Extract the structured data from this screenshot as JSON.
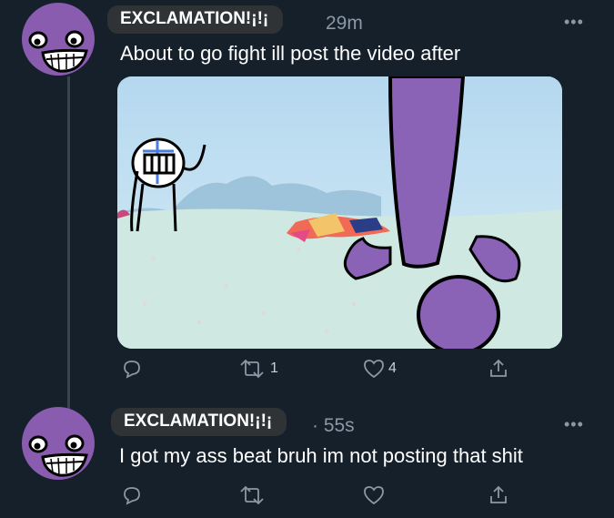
{
  "tweets": [
    {
      "author": "EXCLAMATION!¡!¡",
      "time": "29m",
      "text": "About to go fight ill post the video after",
      "more": "•••",
      "media_description_icon": "video-thumbnail",
      "actions": {
        "reply": "",
        "retweet": "1",
        "like": "4",
        "share": ""
      }
    },
    {
      "author": "EXCLAMATION!¡!¡",
      "time": "· 55s",
      "text": "I got my ass beat bruh im not posting that shit",
      "more": "•••",
      "actions": {
        "reply": "",
        "retweet": "",
        "like": "",
        "share": ""
      }
    }
  ],
  "colors": {
    "background": "#15202b",
    "secondary_text": "#8b98a5",
    "avatar_purple": "#8a5cb0",
    "name_pill": "#2f3336"
  }
}
